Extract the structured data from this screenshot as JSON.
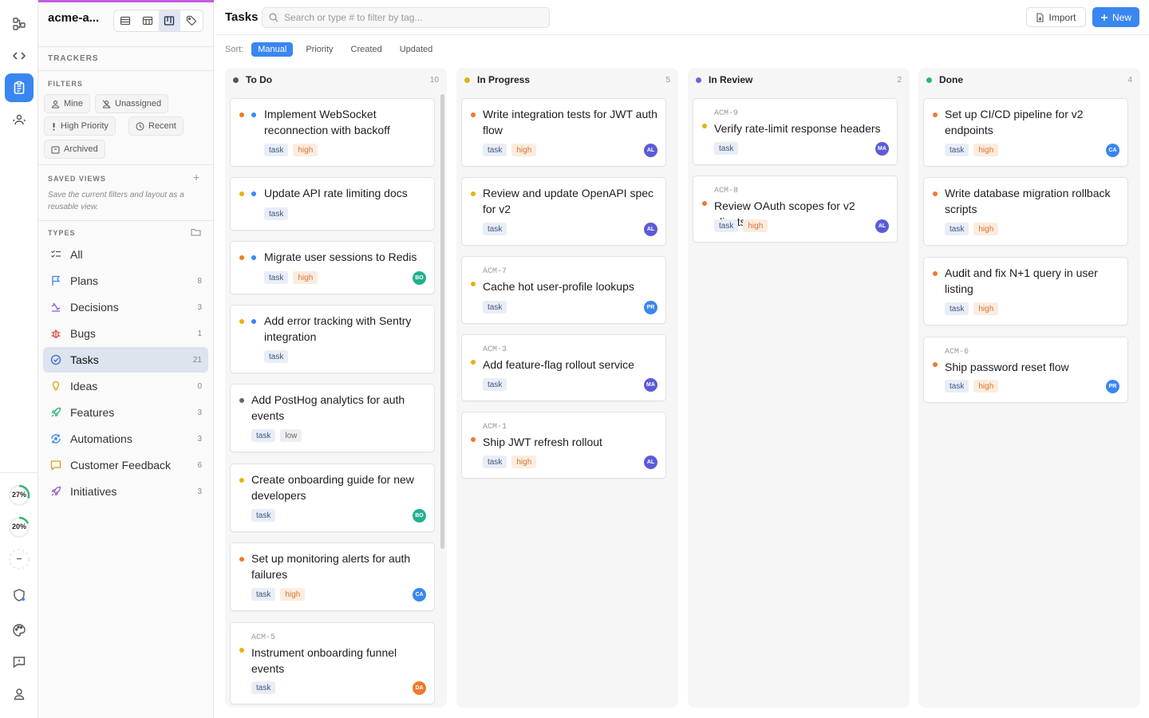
{
  "workspace": {
    "name": "acme-a..."
  },
  "sidebar": {
    "trackers_label": "TRACKERS",
    "filters_label": "FILTERS",
    "filters": [
      "Mine",
      "Unassigned",
      "High Priority",
      "Recent",
      "Archived"
    ],
    "saved_views_label": "SAVED VIEWS",
    "saved_views_hint": "Save the current filters and layout as a reusable view.",
    "types_label": "TYPES",
    "types": [
      {
        "label": "All",
        "count": "",
        "icon": "checklist-icon"
      },
      {
        "label": "Plans",
        "count": "8",
        "icon": "flag-icon"
      },
      {
        "label": "Decisions",
        "count": "3",
        "icon": "scales-icon"
      },
      {
        "label": "Bugs",
        "count": "1",
        "icon": "bug-icon"
      },
      {
        "label": "Tasks",
        "count": "21",
        "icon": "check-circle-icon"
      },
      {
        "label": "Ideas",
        "count": "0",
        "icon": "lightbulb-icon"
      },
      {
        "label": "Features",
        "count": "3",
        "icon": "rocket-icon"
      },
      {
        "label": "Automations",
        "count": "3",
        "icon": "automation-icon"
      },
      {
        "label": "Customer Feedback",
        "count": "6",
        "icon": "chat-icon"
      },
      {
        "label": "Initiatives",
        "count": "3",
        "icon": "rocket-icon"
      }
    ]
  },
  "rail": {
    "meters": [
      "27%",
      "20%",
      "--"
    ]
  },
  "header": {
    "title": "Tasks",
    "search_placeholder": "Search or type # to filter by tag...",
    "import_label": "Import",
    "new_label": "New"
  },
  "sort": {
    "label": "Sort:",
    "options": [
      "Manual",
      "Priority",
      "Created",
      "Updated"
    ],
    "active": "Manual"
  },
  "colors": {
    "accent": "#3a86f0",
    "todo": "#555555",
    "in_progress": "#e8b10f",
    "in_review": "#7a5be0",
    "done": "#2eb872",
    "priority_high": "#ee7a2c",
    "priority_medium": "#e8b10f",
    "priority_low": "#666666",
    "blue_dot": "#3a86f0"
  },
  "columns": [
    {
      "title": "To Do",
      "count": "10",
      "cards": [
        {
          "title": "Implement WebSocket reconnection with backoff",
          "tags": [
            "task",
            "high"
          ]
        },
        {
          "title": "Update API rate limiting docs",
          "tags": [
            "task"
          ]
        },
        {
          "title": "Migrate user sessions to Redis",
          "tags": [
            "task",
            "high"
          ],
          "assignee": "BO"
        },
        {
          "title": "Add error tracking with Sentry integration",
          "tags": [
            "task"
          ]
        },
        {
          "title": "Add PostHog analytics for auth events",
          "tags": [
            "task",
            "low"
          ]
        },
        {
          "title": "Create onboarding guide for new developers",
          "tags": [
            "task"
          ],
          "assignee": "BO"
        },
        {
          "title": "Set up monitoring alerts for auth failures",
          "tags": [
            "task",
            "high"
          ],
          "assignee": "CA"
        },
        {
          "id": "ACM-5",
          "title": "Instrument onboarding funnel events",
          "tags": [
            "task"
          ],
          "assignee": "DA"
        }
      ]
    },
    {
      "title": "In Progress",
      "count": "5",
      "cards": [
        {
          "title": "Write integration tests for JWT auth flow",
          "tags": [
            "task",
            "high"
          ],
          "assignee": "AL"
        },
        {
          "title": "Review and update OpenAPI spec for v2",
          "tags": [
            "task"
          ],
          "assignee": "AL"
        },
        {
          "id": "ACM-7",
          "title": "Cache hot user-profile lookups",
          "tags": [
            "task"
          ],
          "assignee": "PR"
        },
        {
          "id": "ACM-3",
          "title": "Add feature-flag rollout service",
          "tags": [
            "task"
          ],
          "assignee": "MA"
        },
        {
          "id": "ACM-1",
          "title": "Ship JWT refresh rollout",
          "tags": [
            "task",
            "high"
          ],
          "assignee": "AL"
        }
      ]
    },
    {
      "title": "In Review",
      "count": "2",
      "cards": [
        {
          "id": "ACM-9",
          "title": "Verify rate-limit response headers",
          "tags": [
            "task"
          ],
          "assignee": "MA"
        },
        {
          "id": "ACM-8",
          "title": "Review OAuth scopes for v2 clients",
          "tags": [
            "task",
            "high"
          ],
          "assignee": "AL"
        }
      ]
    },
    {
      "title": "Done",
      "count": "4",
      "cards": [
        {
          "title": "Set up CI/CD pipeline for v2 endpoints",
          "tags": [
            "task",
            "high"
          ],
          "assignee": "CA"
        },
        {
          "title": "Write database migration rollback scripts",
          "tags": [
            "task",
            "high"
          ]
        },
        {
          "title": "Audit and fix N+1 query in user listing",
          "tags": [
            "task",
            "high"
          ]
        },
        {
          "id": "ACM-6",
          "title": "Ship password reset flow",
          "tags": [
            "task",
            "high"
          ],
          "assignee": "PR"
        }
      ]
    }
  ]
}
